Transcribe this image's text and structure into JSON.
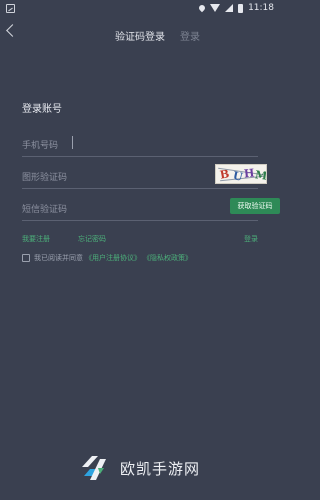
{
  "status_bar": {
    "time": "11:18"
  },
  "header": {
    "title": "验证码登录",
    "alt_tab": "登录"
  },
  "form": {
    "section_title": "登录账号",
    "phone_label": "手机号码",
    "captcha_label": "图形验证码",
    "captcha_chars": [
      "B",
      "U",
      "H",
      "M"
    ],
    "sms_label": "短信验证码",
    "get_code_button": "获取验证码"
  },
  "links": {
    "register": "我要注册",
    "forgot": "忘记密码",
    "login": "登录"
  },
  "agreement": {
    "prefix": "我已阅读并同意",
    "user_agreement": "《用户注册协议》",
    "privacy_policy": "《隐私权政策》"
  },
  "branding": {
    "name": "欧凯手游网"
  },
  "colors": {
    "background": "#3a4050",
    "accent": "#2e8a57",
    "link": "#4cb07a"
  }
}
